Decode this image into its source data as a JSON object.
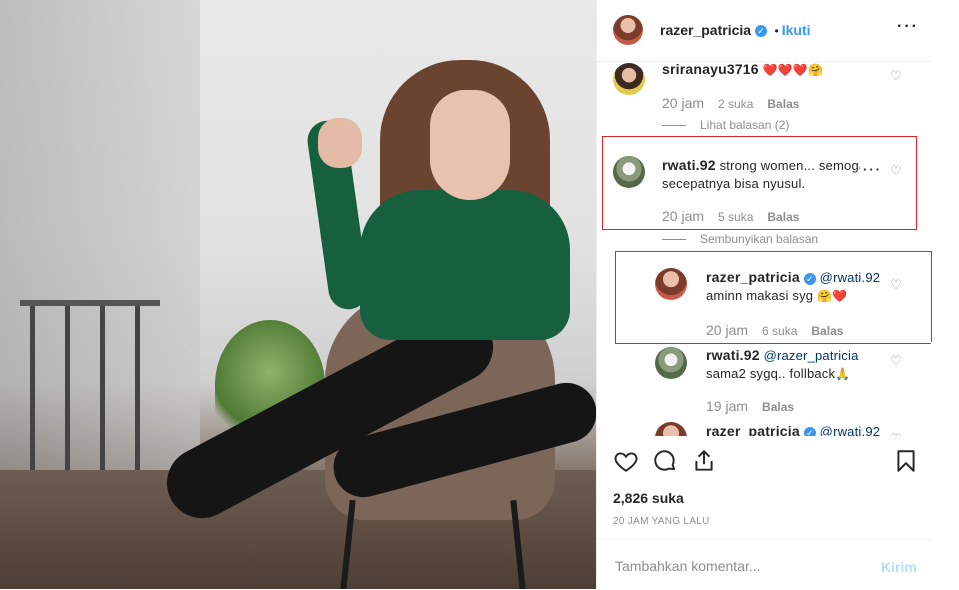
{
  "post": {
    "author": "razer_patricia",
    "follow_separator": "•",
    "follow_label": "Ikuti",
    "more_icon": "more-horizontal-icon",
    "photo_alt": "razer_patricia"
  },
  "comments": [
    {
      "user": "sriranayu3716",
      "text": "",
      "emoji": "❤️❤️❤️🤗",
      "time": "20 jam",
      "likes": "2 suka",
      "reply_label": "Balas",
      "view_replies": "Lihat balasan (2)"
    },
    {
      "user": "rwati.92",
      "text": "strong women... semoga secepatnya bisa nyusul.",
      "time": "20 jam",
      "likes": "5 suka",
      "reply_label": "Balas",
      "hide_replies": "Sembunyikan balasan"
    },
    {
      "user": "razer_patricia",
      "mention": "@rwati.92",
      "text": "aminn makasi syg",
      "emoji": "🤗❤️",
      "time": "20 jam",
      "likes": "6 suka",
      "reply_label": "Balas"
    },
    {
      "user": "rwati.92",
      "mention": "@razer_patricia",
      "text": "sama2 sygq.. follback",
      "emoji": "🙏",
      "time": "19 jam",
      "reply_label": "Balas"
    },
    {
      "user": "razer_patricia",
      "mention": "@rwati.92"
    }
  ],
  "actions": {
    "like_icon": "heart-icon",
    "comment_icon": "comment-icon",
    "share_icon": "share-icon",
    "save_icon": "bookmark-icon"
  },
  "likes_count": "2,826 suka",
  "time_ago": "20 JAM YANG LALU",
  "add_comment": {
    "placeholder": "Tambahkan komentar...",
    "post_label": "Kirim"
  },
  "colors": {
    "link": "#3897f0",
    "highlight": "#d9262b",
    "muted": "#8e8e8e",
    "text": "#262626"
  }
}
